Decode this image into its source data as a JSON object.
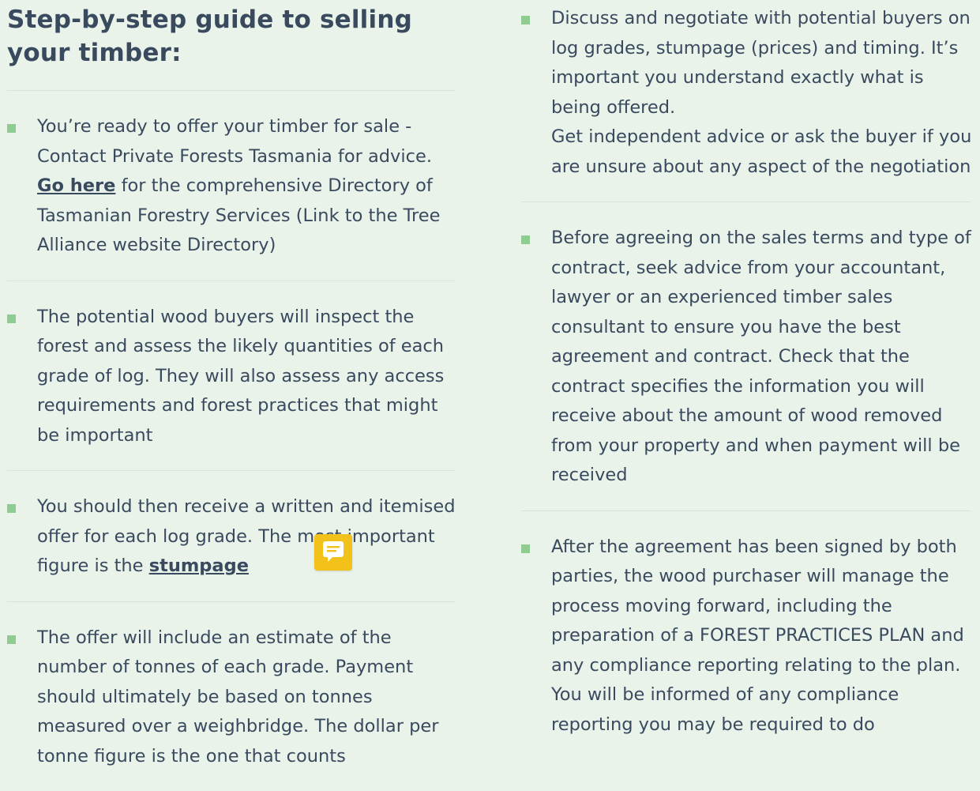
{
  "heading": {
    "line1": "Step-by-step guide to selling",
    "line2": "your timber:"
  },
  "left_items": [
    {
      "part_before_link": "You’re ready to offer your timber for sale - Contact Private Forests Tasmania for advice.",
      "link_text": "Go here",
      "part_after_link": "for the comprehensive Directory of Tasmanian Forestry Services (Link to the Tree Alliance website Directory)"
    },
    {
      "text": "The potential wood buyers will inspect the forest and assess the likely quantities of each grade of log. They will also assess any access requirements and forest practices that might be important"
    },
    {
      "text_before_link": "You should then receive a written and itemised offer for each log grade. The most important figure is the",
      "link_text": "stumpage"
    },
    {
      "text": "The offer will include an estimate of the number of tonnes of each grade. Payment should ultimately be based on tonnes measured over a weighbridge. The dollar per tonne figure is the one that counts"
    }
  ],
  "right_items": [
    {
      "text": "Discuss and negotiate with potential buyers on log grades, stumpage (prices) and timing. It’s important you understand exactly what is being offered.",
      "text2": "Get independent advice or ask the buyer if you are unsure about any aspect of the negotiation"
    },
    {
      "text": "Before agreeing on the sales terms and type of contract, seek advice from your accountant, lawyer or an experienced timber sales consultant to ensure you have the best agreement and contract. Check that the contract specifies the information you will receive about the amount of wood removed from your property and when payment will be received"
    },
    {
      "text": "After the agreement has been signed by both parties, the wood purchaser will manage the process moving forward, including the preparation of a FOREST PRACTICES PLAN and any compliance reporting relating to the plan. You will be informed of any compliance reporting you may be required to do"
    }
  ],
  "icons": {
    "bullet": "square-bullet-icon",
    "chat": "chat-message-icon"
  },
  "colors": {
    "background": "#e9f3ea",
    "text": "#3a4a5e",
    "bullet": "#8fcc92",
    "chat_widget": "#f3c21a",
    "divider": "#d6e3d8"
  }
}
